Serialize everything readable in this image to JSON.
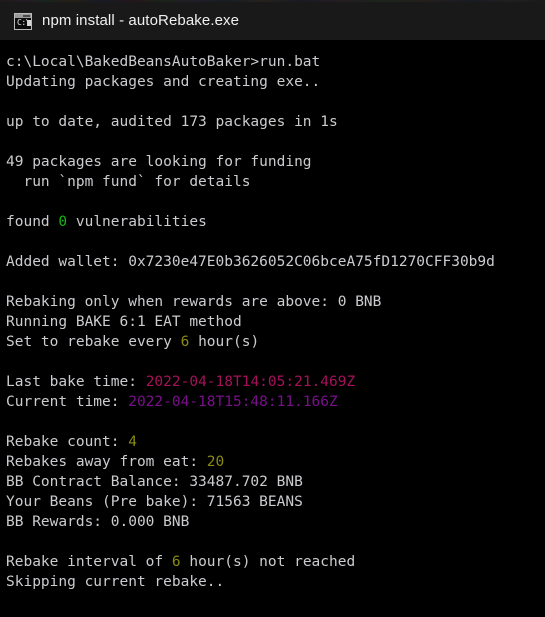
{
  "window": {
    "title": "npm install - autoRebake.exe",
    "icon": "cmd-console-icon",
    "icon_prompt_text": "C:\\",
    "titlebar_background": "#191919",
    "titlebar_text_color": "#f0f0f0",
    "console_background": "#000000",
    "console_text_color": "#ccccd0"
  },
  "palette": {
    "default": "#ccccd0",
    "green": "#12b812",
    "olive": "#8a8a12",
    "crimson": "#a6115a",
    "purple": "#7a0f8c"
  },
  "console": {
    "lines": [
      {
        "id": "prompt-run-bat",
        "text": "c:\\Local\\BakedBeansAutoBaker>run.bat"
      },
      {
        "id": "updating-packages",
        "text": "Updating packages and creating exe.."
      },
      {
        "id": "blank-1",
        "text": ""
      },
      {
        "id": "npm-audited",
        "text": "up to date, audited 173 packages in 1s"
      },
      {
        "id": "blank-2",
        "text": ""
      },
      {
        "id": "npm-funding",
        "text": "49 packages are looking for funding"
      },
      {
        "id": "npm-funding-details",
        "text": "  run `npm fund` for details"
      },
      {
        "id": "blank-3",
        "text": ""
      },
      {
        "id": "npm-vulnerabilities",
        "text": "found 0 vulnerabilities"
      },
      {
        "id": "blank-4",
        "text": ""
      },
      {
        "id": "added-wallet",
        "text": "Added wallet: 0x7230e47E0b3626052C06bceA75fD1270CFF30b9d"
      },
      {
        "id": "blank-5",
        "text": ""
      },
      {
        "id": "rewards-threshold",
        "text": "Rebaking only when rewards are above: 0 BNB"
      },
      {
        "id": "bake-method",
        "text": "Running BAKE 6:1 EAT method"
      },
      {
        "id": "rebake-interval-set",
        "text": "Set to rebake every 6 hour(s)"
      },
      {
        "id": "blank-6",
        "text": ""
      },
      {
        "id": "last-bake-time",
        "text": "Last bake time: 2022-04-18T14:05:21.469Z"
      },
      {
        "id": "current-time",
        "text": "Current time: 2022-04-18T15:48:11.166Z"
      },
      {
        "id": "blank-7",
        "text": ""
      },
      {
        "id": "rebake-count",
        "text": "Rebake count: 4"
      },
      {
        "id": "rebakes-away-from-eat",
        "text": "Rebakes away from eat: 20"
      },
      {
        "id": "bb-contract-balance",
        "text": "BB Contract Balance: 33487.702 BNB"
      },
      {
        "id": "your-beans-pre-bake",
        "text": "Your Beans (Pre bake): 71563 BEANS"
      },
      {
        "id": "bb-rewards",
        "text": "BB Rewards: 0.000 BNB"
      },
      {
        "id": "blank-8",
        "text": ""
      },
      {
        "id": "interval-not-reached",
        "text": "Rebake interval of 6 hour(s) not reached"
      },
      {
        "id": "skipping-rebake",
        "text": "Skipping current rebake.."
      }
    ],
    "segments": {
      "prompt-run-bat": [
        {
          "t": "c:\\Local\\BakedBeansAutoBaker>run.bat",
          "c": "default"
        }
      ],
      "updating-packages": [
        {
          "t": "Updating packages and creating exe..",
          "c": "default"
        }
      ],
      "npm-audited": [
        {
          "t": "up to date, audited 173 packages in 1s",
          "c": "default"
        }
      ],
      "npm-funding": [
        {
          "t": "49 packages are looking for funding",
          "c": "default"
        }
      ],
      "npm-funding-details": [
        {
          "t": "  run `npm fund` for details",
          "c": "default"
        }
      ],
      "npm-vulnerabilities": [
        {
          "t": "found ",
          "c": "default"
        },
        {
          "t": "0",
          "c": "green"
        },
        {
          "t": " vulnerabilities",
          "c": "default"
        }
      ],
      "added-wallet": [
        {
          "t": "Added wallet: 0x7230e47E0b3626052C06bceA75fD1270CFF30b9d",
          "c": "default"
        }
      ],
      "rewards-threshold": [
        {
          "t": "Rebaking only when rewards are above: 0 BNB",
          "c": "default"
        }
      ],
      "bake-method": [
        {
          "t": "Running BAKE 6:1 EAT method",
          "c": "default"
        }
      ],
      "rebake-interval-set": [
        {
          "t": "Set to rebake every ",
          "c": "default"
        },
        {
          "t": "6",
          "c": "olive"
        },
        {
          "t": " hour(s)",
          "c": "default"
        }
      ],
      "last-bake-time": [
        {
          "t": "Last bake time: ",
          "c": "default"
        },
        {
          "t": "2022-04-18T14:05:21.469Z",
          "c": "crimson"
        }
      ],
      "current-time": [
        {
          "t": "Current time: ",
          "c": "default"
        },
        {
          "t": "2022-04-18T15:48:11.166Z",
          "c": "purple"
        }
      ],
      "rebake-count": [
        {
          "t": "Rebake count: ",
          "c": "default"
        },
        {
          "t": "4",
          "c": "olive"
        }
      ],
      "rebakes-away-from-eat": [
        {
          "t": "Rebakes away from eat: ",
          "c": "default"
        },
        {
          "t": "20",
          "c": "olive"
        }
      ],
      "bb-contract-balance": [
        {
          "t": "BB Contract Balance: 33487.702 BNB",
          "c": "default"
        }
      ],
      "your-beans-pre-bake": [
        {
          "t": "Your Beans (Pre bake): 71563 BEANS",
          "c": "default"
        }
      ],
      "bb-rewards": [
        {
          "t": "BB Rewards: 0.000 BNB",
          "c": "default"
        }
      ],
      "interval-not-reached": [
        {
          "t": "Rebake interval of ",
          "c": "default"
        },
        {
          "t": "6",
          "c": "olive"
        },
        {
          "t": " hour(s) not reached",
          "c": "default"
        }
      ],
      "skipping-rebake": [
        {
          "t": "Skipping current rebake..",
          "c": "default"
        }
      ]
    }
  },
  "values": {
    "working_directory": "c:\\Local\\BakedBeansAutoBaker",
    "command": "run.bat",
    "audited_packages": 173,
    "audit_duration": "1s",
    "funding_packages": 49,
    "vulnerabilities": 0,
    "wallet_address": "0x7230e47E0b3626052C06bceA75fD1270CFF30b9d",
    "reward_threshold_bnb": 0,
    "bake_method": "BAKE 6:1 EAT",
    "rebake_interval_hours": 6,
    "last_bake_time": "2022-04-18T14:05:21.469Z",
    "current_time": "2022-04-18T15:48:11.166Z",
    "rebake_count": 4,
    "rebakes_away_from_eat": 20,
    "bb_contract_balance_bnb": "33487.702",
    "your_beans_pre_bake": "71563",
    "bb_rewards_bnb": "0.000"
  }
}
